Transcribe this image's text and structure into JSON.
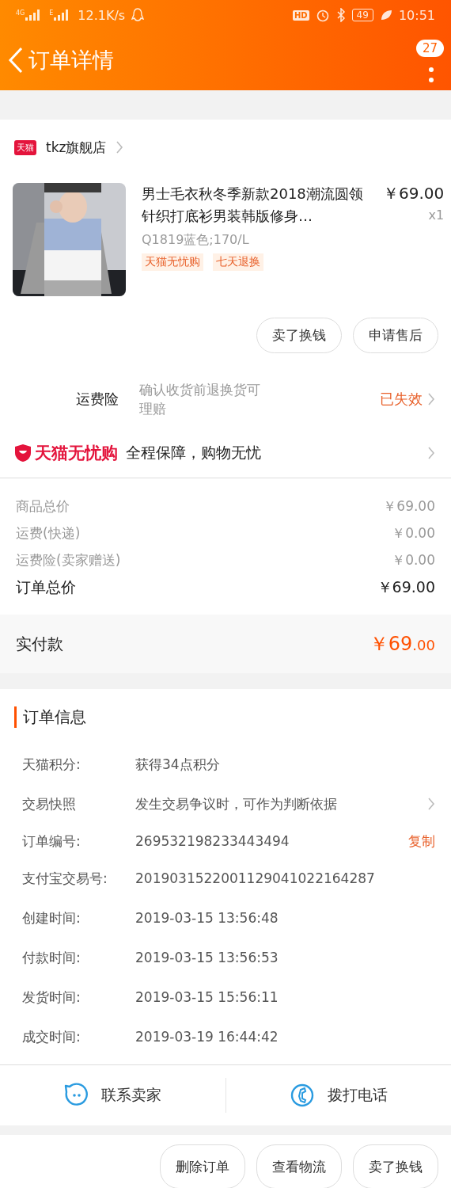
{
  "status_bar": {
    "signal_labels": [
      "4G",
      "E"
    ],
    "network_speed": "12.1K/s",
    "hd_badge": "HD",
    "battery": "49",
    "time": "10:51"
  },
  "header": {
    "title": "订单详情",
    "badge": "27"
  },
  "store": {
    "tag": "天猫",
    "name": "tkz旗舰店"
  },
  "product": {
    "kind": "picture",
    "title": "男士毛衣秋冬季新款2018潮流圆领针织打底衫男装韩版修身…",
    "price": "￥69.00",
    "quantity": "x1",
    "sku": "Q1819蓝色;170/L",
    "tags": [
      "天猫无忧购",
      "七天退换"
    ]
  },
  "item_actions": [
    "卖了换钱",
    "申请售后"
  ],
  "insurance": {
    "label": "运费险",
    "description": "确认收货前退换货可理赔",
    "status": "已失效"
  },
  "guarantee": {
    "brand": "天猫无忧购",
    "text": "全程保障，购物无忧"
  },
  "costs": [
    {
      "kind": "minor",
      "label": "商品总价",
      "value": "￥69.00"
    },
    {
      "kind": "minor",
      "label": "运费(快递)",
      "value": "￥0.00"
    },
    {
      "kind": "minor",
      "label": "运费险(卖家赠送)",
      "value": "￥0.00"
    },
    {
      "kind": "total",
      "label": "订单总价",
      "value": "￥69.00"
    }
  ],
  "paid": {
    "label": "实付款",
    "amount": "￥69",
    "decimals": ".00"
  },
  "order_info": {
    "title": "订单信息",
    "rows": [
      {
        "kind": "plain",
        "label": "天猫积分:",
        "value": "获得34点积分"
      },
      {
        "kind": "arrow",
        "label": "交易快照",
        "value": "发生交易争议时，可作为判断依据"
      },
      {
        "kind": "copy",
        "label": "订单编号:",
        "value": "269532198233443494",
        "action": "复制"
      },
      {
        "kind": "plain",
        "label": "支付宝交易号:",
        "value": "2019031522001129041022164287"
      },
      {
        "kind": "plain",
        "label": "创建时间:",
        "value": "2019-03-15 13:56:48"
      },
      {
        "kind": "plain",
        "label": "付款时间:",
        "value": "2019-03-15 13:56:53"
      },
      {
        "kind": "plain",
        "label": "发货时间:",
        "value": "2019-03-15 15:56:11"
      },
      {
        "kind": "plain",
        "label": "成交时间:",
        "value": "2019-03-19 16:44:42"
      }
    ]
  },
  "contact": [
    {
      "kind": "chat",
      "label": "联系卖家"
    },
    {
      "kind": "phone",
      "label": "拨打电话"
    }
  ],
  "bottom_actions": [
    "删除订单",
    "查看物流",
    "卖了换钱"
  ]
}
